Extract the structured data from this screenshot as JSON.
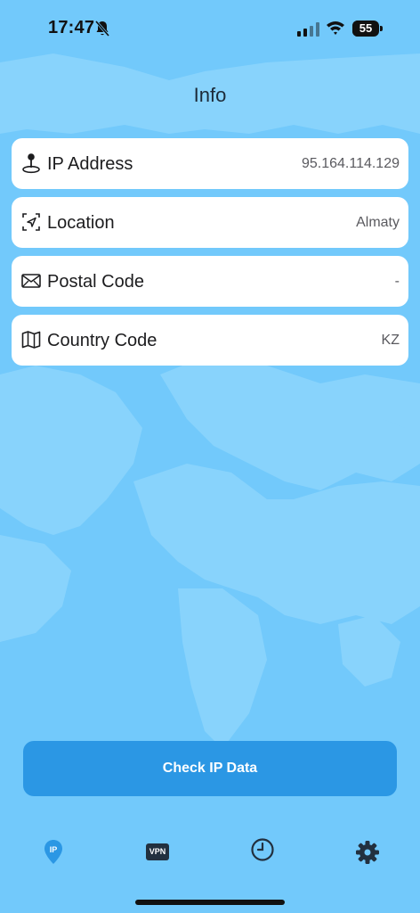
{
  "status_bar": {
    "time": "17:47",
    "battery_text": "55",
    "battery_level": 0.55
  },
  "header": {
    "title": "Info"
  },
  "info": [
    {
      "label": "IP Address",
      "value": "95.164.114.129",
      "icon": "map-pin-icon"
    },
    {
      "label": "Location",
      "value": "Almaty",
      "icon": "location-arrow-icon"
    },
    {
      "label": "Postal Code",
      "value": "-",
      "icon": "envelope-icon"
    },
    {
      "label": "Country Code",
      "value": "KZ",
      "icon": "map-icon"
    }
  ],
  "actions": {
    "check_label": "Check IP Data"
  },
  "tabs": [
    {
      "name": "ip",
      "badge": "IP",
      "icon": "ip-pin-icon",
      "active": true
    },
    {
      "name": "vpn",
      "badge": "VPN",
      "icon": "vpn-icon",
      "active": false
    },
    {
      "name": "history",
      "icon": "clock-icon",
      "active": false
    },
    {
      "name": "settings",
      "icon": "gear-icon",
      "active": false
    }
  ],
  "colors": {
    "background": "#72c9fb",
    "accent": "#2b97e4",
    "card": "#ffffff",
    "tab_active": "#2b97e4",
    "tab_inactive": "#22303f"
  }
}
